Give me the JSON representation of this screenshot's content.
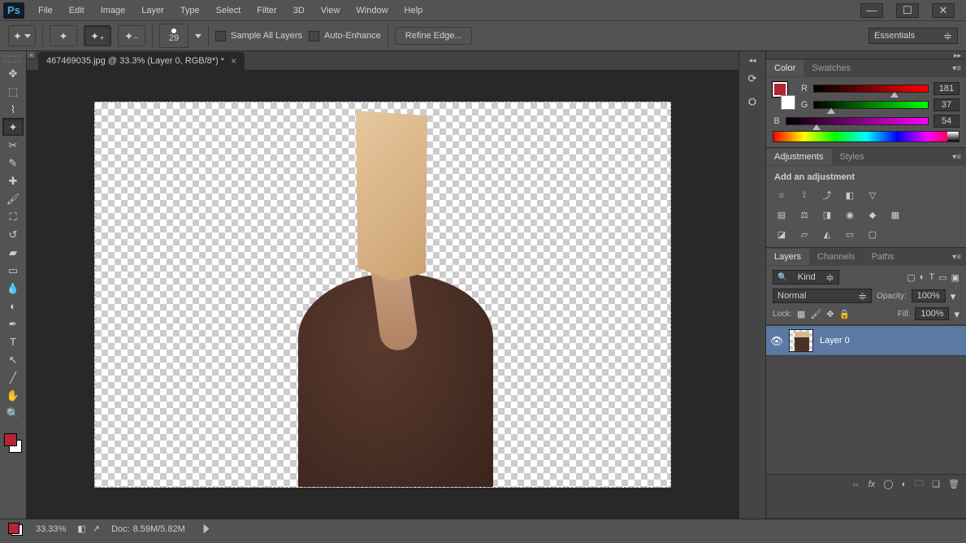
{
  "app": {
    "logo": "Ps"
  },
  "menu": [
    "File",
    "Edit",
    "Image",
    "Layer",
    "Type",
    "Select",
    "Filter",
    "3D",
    "View",
    "Window",
    "Help"
  ],
  "options": {
    "brush_size": "29",
    "sample_all_layers": "Sample All Layers",
    "auto_enhance": "Auto-Enhance",
    "refine_edge": "Refine Edge...",
    "workspace": "Essentials"
  },
  "document": {
    "tab_title": "467469035.jpg @ 33.3% (Layer 0, RGB/8*) *"
  },
  "panels": {
    "color": {
      "tabs": [
        "Color",
        "Swatches"
      ],
      "r_label": "R",
      "r_value": "181",
      "g_label": "G",
      "g_value": "37",
      "b_label": "B",
      "b_value": "54"
    },
    "adjustments": {
      "tabs": [
        "Adjustments",
        "Styles"
      ],
      "hint": "Add an adjustment"
    },
    "layers": {
      "tabs": [
        "Layers",
        "Channels",
        "Paths"
      ],
      "filter_kind": "Kind",
      "blend_mode": "Normal",
      "opacity_label": "Opacity:",
      "opacity_value": "100%",
      "lock_label": "Lock:",
      "fill_label": "Fill:",
      "fill_value": "100%",
      "layer0_name": "Layer 0"
    }
  },
  "status": {
    "zoom": "33.33%",
    "doc_label": "Doc:",
    "doc_size": "8.59M/5.82M"
  }
}
